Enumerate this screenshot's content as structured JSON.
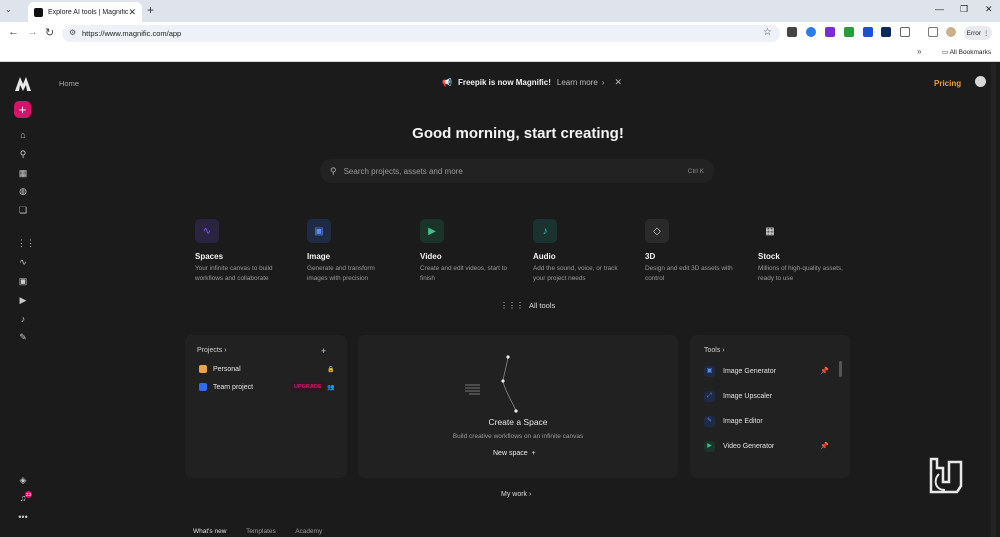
{
  "browser": {
    "tab_title": "Explore AI tools | Magnific AI",
    "tab_close": "✕",
    "new_tab": "+",
    "url": "https://www.magnific.com/app",
    "profile_button": "Error",
    "bookmarks_all": "All Bookmarks"
  },
  "header": {
    "breadcrumb": "Home",
    "banner_text": "Freepik is now Magnific!",
    "banner_link": "Learn more",
    "pricing": "Pricing"
  },
  "sidebar": {
    "notification_count": "23"
  },
  "main": {
    "greeting": "Good morning, start creating!",
    "search_placeholder": "Search projects, assets and more",
    "search_shortcut": "Ctrl K",
    "tools": [
      {
        "name": "Spaces",
        "desc": "Your infinite canvas to build workflows and collaborate",
        "color": "#8a5cf6"
      },
      {
        "name": "Image",
        "desc": "Generate and transform images with precision",
        "color": "#5b8cf6"
      },
      {
        "name": "Video",
        "desc": "Create and edit videos, start to finish",
        "color": "#3fc28a"
      },
      {
        "name": "Audio",
        "desc": "Add the sound, voice, or track your project needs",
        "color": "#2fc5b8"
      },
      {
        "name": "3D",
        "desc": "Design and edit 3D assets with control",
        "color": "#cfcfcf"
      },
      {
        "name": "Stock",
        "desc": "Millions of high-quality assets, ready to use",
        "color": "#e8e8e8"
      }
    ],
    "all_tools": "All tools",
    "projects": {
      "title": "Projects",
      "items": [
        {
          "name": "Personal",
          "color": "#f0a24a"
        },
        {
          "name": "Team project",
          "color": "#2f6df0",
          "badge": "UPGRADE"
        }
      ]
    },
    "space": {
      "title": "Create a Space",
      "subtitle": "Build creative workflows on an infinite canvas",
      "button": "New space"
    },
    "tools_panel": {
      "title": "Tools",
      "items": [
        {
          "name": "Image Generator",
          "pinned": true
        },
        {
          "name": "Image Upscaler",
          "pinned": false
        },
        {
          "name": "Image Editor",
          "pinned": false
        },
        {
          "name": "Video Generator",
          "pinned": true
        }
      ]
    },
    "my_work": "My work",
    "bottom_tabs": [
      "What's new",
      "Templates",
      "Academy"
    ]
  },
  "colors": {
    "accent": "#d6136a",
    "pricing": "#ec9d3b",
    "background": "#1b1b1b"
  }
}
